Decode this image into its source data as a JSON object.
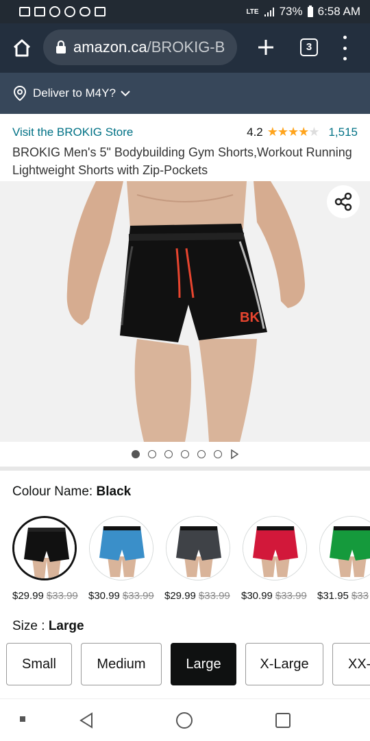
{
  "status": {
    "battery": "73%",
    "time": "6:58 AM",
    "network": "LTE"
  },
  "browser": {
    "url_host": "amazon.ca",
    "url_path": "/BROKIG-B",
    "tab_count": "3"
  },
  "deliver": {
    "label": "Deliver to M4Y?"
  },
  "product": {
    "store": "Visit the BROKIG Store",
    "rating": "4.2",
    "rating_stars": 4.2,
    "rating_count": "1,515",
    "title": "BROKIG Men's 5\" Bodybuilding Gym Shorts,Workout Running Lightweight Shorts with Zip-Pockets"
  },
  "colour": {
    "label": "Colour Name: ",
    "selected": "Black"
  },
  "swatches": [
    {
      "color": "#111111",
      "price": "$29.99",
      "old": "$33.99"
    },
    {
      "color": "#3a8fc9",
      "price": "$30.99",
      "old": "$33.99"
    },
    {
      "color": "#3f4247",
      "price": "$29.99",
      "old": "$33.99"
    },
    {
      "color": "#d2183a",
      "price": "$30.99",
      "old": "$33.99"
    },
    {
      "color": "#159a3c",
      "price": "$31.95",
      "old": "$33"
    }
  ],
  "size": {
    "label": "Size : ",
    "selected": "Large",
    "options": [
      "Small",
      "Medium",
      "Large",
      "X-Large",
      "XX-"
    ]
  },
  "icons": {
    "home": "home-icon",
    "lock": "lock-icon",
    "share": "share-icon",
    "pin": "location-pin-icon"
  }
}
